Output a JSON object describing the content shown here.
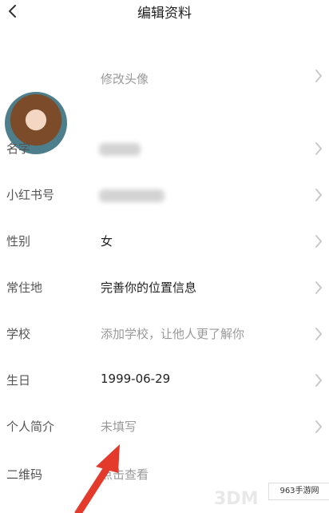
{
  "header": {
    "title": "编辑资料"
  },
  "avatar_row": {
    "label": "修改头像"
  },
  "fields": [
    {
      "label": "名字",
      "value": "",
      "state": "blurred"
    },
    {
      "label": "小红书号",
      "value": "",
      "state": "blurred"
    },
    {
      "label": "性别",
      "value": "女",
      "state": "partial"
    },
    {
      "label": "常住地",
      "value": "完善你的位置信息",
      "state": "filled"
    },
    {
      "label": "学校",
      "value": "添加学校，让他人更了解你",
      "state": "hint"
    },
    {
      "label": "生日",
      "value": "1999-06-29",
      "state": "filled"
    },
    {
      "label": "个人简介",
      "value": "未填写",
      "state": "hint"
    },
    {
      "label": "二维码",
      "value": "点击查看",
      "state": "hint"
    }
  ],
  "watermark": {
    "badge": "963手游网",
    "brand": "3DM"
  },
  "colors": {
    "label": "#555555",
    "hint": "#999999",
    "filled": "#222222",
    "chevron": "#c9c9c9",
    "arrow": "#e33a2c"
  }
}
